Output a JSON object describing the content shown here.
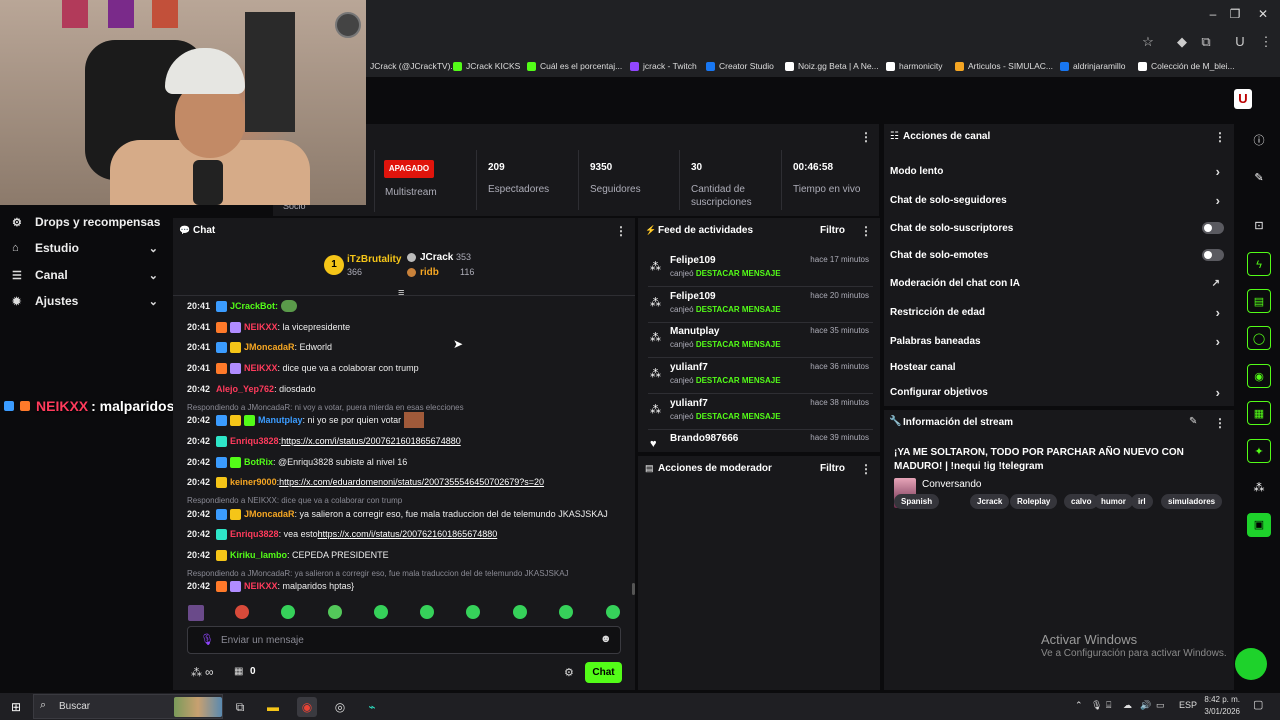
{
  "browser": {
    "bookmarks": [
      {
        "label": "JCrack (@JCrackTV)...",
        "color": "#000000"
      },
      {
        "label": "JCrack KICKS",
        "color": "#53fc18"
      },
      {
        "label": "Cuál es el porcentaj...",
        "color": "#53fc18"
      },
      {
        "label": "jcrack - Twitch",
        "color": "#9146ff"
      },
      {
        "label": "Creator Studio",
        "color": "#1877f2"
      },
      {
        "label": "Noiz.gg Beta | A Ne...",
        "color": "#ffffff"
      },
      {
        "label": "harmonicity",
        "color": "#ffffff"
      },
      {
        "label": "Articulos - SIMULAC...",
        "color": "#f5a623"
      },
      {
        "label": "aldrinjaramillo",
        "color": "#1877f2"
      },
      {
        "label": "Colección de M_blei...",
        "color": "#ffffff"
      }
    ]
  },
  "overlay_chat": {
    "user": "NEIKXX",
    "text": ": malparidos hptas)"
  },
  "sidebar": {
    "items": [
      {
        "label": "Drops y recompensas",
        "icon": "drops-icon"
      },
      {
        "label": "Estudio",
        "icon": "studio-icon"
      },
      {
        "label": "Canal",
        "icon": "channel-icon"
      },
      {
        "label": "Ajustes",
        "icon": "gear-icon"
      }
    ]
  },
  "stats": {
    "status_badge": "APAGADO",
    "multistream_label": "Multistream",
    "socio_label": "Socio",
    "viewers_value": "209",
    "viewers_label": "Espectadores",
    "followers_value": "9350",
    "followers_label": "Seguidores",
    "subs_value": "30",
    "subs_label": "Cantidad de suscripciones",
    "live_value": "00:46:58",
    "live_label": "Tiempo en vivo"
  },
  "chat": {
    "title": "Chat",
    "top_gifters": [
      {
        "name": "iTzBrutality",
        "count": "366",
        "rank": "1"
      },
      {
        "name": "JCrack",
        "count": "353"
      },
      {
        "name": "ridb",
        "count": "116"
      }
    ],
    "messages": [
      {
        "time": "20:41",
        "user": "JCrackBot:",
        "user_color": "#53fc18",
        "text": "",
        "type": "plain"
      },
      {
        "time": "20:41",
        "user": "NEIKXX",
        "user_color": "#ff3b5c",
        "text": ": la vicepresidente",
        "type": "plain"
      },
      {
        "time": "20:41",
        "user": "JMoncadaR",
        "user_color": "#f5a623",
        "text": ": Edworld",
        "type": "plain"
      },
      {
        "time": "20:41",
        "user": "NEIKXX",
        "user_color": "#ff3b5c",
        "text": ": dice que va a colaborar con trump",
        "type": "plain"
      },
      {
        "time": "20:42",
        "user": "Alejo_Yep762",
        "user_color": "#ff3b5c",
        "text": ": diosdado",
        "type": "plain"
      },
      {
        "time": "20:42",
        "user": "Manutplay",
        "user_color": "#3b9cff",
        "text": ": ni yo se por quien votar",
        "type": "plain"
      },
      {
        "time": "20:42",
        "user": "Enriqu3828",
        "user_color": "#ff3b5c",
        "text": ": ",
        "link": "https://x.com/i/status/2007621601865674880",
        "type": "link"
      },
      {
        "time": "20:42",
        "user": "BotRix",
        "user_color": "#53fc18",
        "text": ": @Enriqu3828 subiste al nivel 16",
        "type": "plain"
      },
      {
        "time": "20:42",
        "user": "keiner9000",
        "user_color": "#f5a623",
        "text": ": ",
        "link": "https://x.com/eduardomenoni/status/2007355546450702679?s=20",
        "type": "link"
      },
      {
        "time": "20:42",
        "user": "JMoncadaR",
        "user_color": "#f5a623",
        "text": ": ya salieron a corregir eso, fue mala traduccion del de telemundo JKASJSKAJ",
        "type": "plain"
      },
      {
        "time": "20:42",
        "user": "Enriqu3828",
        "user_color": "#ff3b5c",
        "text": ": vea esto ",
        "link": "https://x.com/i/status/2007621601865674880",
        "type": "link"
      },
      {
        "time": "20:42",
        "user": "Kiriku_lambo",
        "user_color": "#53fc18",
        "text": ": CEPEDA PRESIDENTE",
        "type": "plain"
      },
      {
        "time": "20:42",
        "user": "NEIKXX",
        "user_color": "#ff3b5c",
        "text": ": malparidos hptas}",
        "type": "plain"
      }
    ],
    "replies": [
      "Respondiendo a JMoncadaR: ni voy a votar, puera mierda en esas elecciones",
      "Respondiendo a NEIKXX: dice que va a colaborar con trump",
      "Respondiendo a JMoncadaR: ya salieron a corregir eso, fue mala traduccion del de telemundo JKASJSKAJ"
    ],
    "input_placeholder": "Enviar un mensaje",
    "points_value": "∞",
    "store_value": "0",
    "send_label": "Chat"
  },
  "activity": {
    "title": "Feed de actividades",
    "filter_label": "Filtro",
    "items": [
      {
        "name": "Felipe109",
        "action": "canjeó",
        "reward": "DESTACAR MENSAJE",
        "ago": "hace 17 minutos"
      },
      {
        "name": "Felipe109",
        "action": "canjeó",
        "reward": "DESTACAR MENSAJE",
        "ago": "hace 20 minutos"
      },
      {
        "name": "Manutplay",
        "action": "canjeó",
        "reward": "DESTACAR MENSAJE",
        "ago": "hace 35 minutos"
      },
      {
        "name": "yulianf7",
        "action": "canjeó",
        "reward": "DESTACAR MENSAJE",
        "ago": "hace 36 minutos"
      },
      {
        "name": "yulianf7",
        "action": "canjeó",
        "reward": "DESTACAR MENSAJE",
        "ago": "hace 38 minutos"
      },
      {
        "name": "Brando987666",
        "action": "",
        "reward": "",
        "ago": "hace 39 minutos"
      }
    ]
  },
  "moderator": {
    "title": "Acciones de moderador",
    "filter_label": "Filtro"
  },
  "channel_actions": {
    "title": "Acciones de canal",
    "options": [
      {
        "label": "Modo lento",
        "control": "arrow"
      },
      {
        "label": "Chat de solo-seguidores",
        "control": "arrow"
      },
      {
        "label": "Chat de solo-suscriptores",
        "control": "toggle"
      },
      {
        "label": "Chat de solo-emotes",
        "control": "toggle"
      },
      {
        "label": "Moderación del chat con IA",
        "control": "external"
      },
      {
        "label": "Restricción de edad",
        "control": "arrow"
      },
      {
        "label": "Palabras baneadas",
        "control": "arrow"
      },
      {
        "label": "Hostear canal",
        "control": "none"
      },
      {
        "label": "Configurar objetivos",
        "control": "arrow"
      }
    ]
  },
  "stream_info": {
    "title": "Información del stream",
    "stream_title": "¡YA ME SOLTARON, TODO POR PARCHAR AÑO NUEVO CON MADURO! | !nequi !ig !telegram",
    "category": "Conversando",
    "tags": [
      "Spanish",
      "Jcrack",
      "Roleplay",
      "calvo",
      "humor",
      "irl",
      "simuladores"
    ]
  },
  "watermark": {
    "line1": "Activar Windows",
    "line2": "Ve a Configuración para activar Windows."
  },
  "taskbar": {
    "search_label": "Buscar",
    "lang": "ESP",
    "time": "8:42 p. m.",
    "date": "3/01/2026"
  }
}
